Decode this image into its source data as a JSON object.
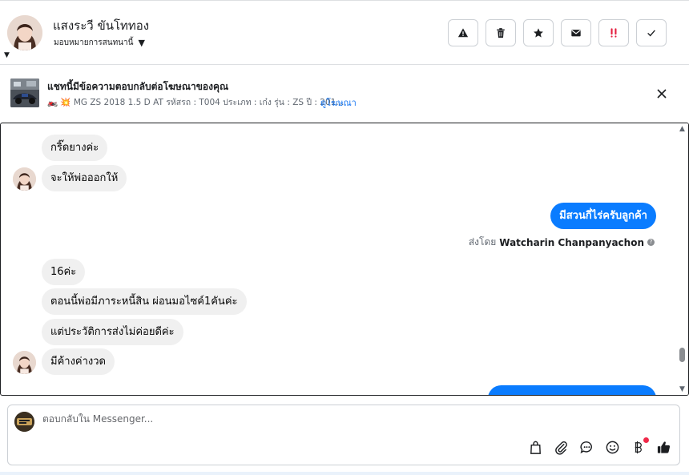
{
  "header": {
    "contact_name": "แสงระวี ขันโททอง",
    "assign_label": "มอบหมายการสนทนานี้",
    "actions": [
      {
        "name": "report-button",
        "icon": "warning-icon"
      },
      {
        "name": "delete-button",
        "icon": "trash-icon"
      },
      {
        "name": "star-button",
        "icon": "star-icon"
      },
      {
        "name": "mark-unread-button",
        "icon": "envelope-icon"
      },
      {
        "name": "follow-up-button",
        "icon": "double-exclamation-icon"
      },
      {
        "name": "mark-done-button",
        "icon": "check-icon"
      }
    ]
  },
  "ad_reply": {
    "title": "แชทนี้มีข้อความตอบกลับต่อโฆษณาของคุณ",
    "subtitle": "🏍️ 💥 MG ZS 2018 1.5 D AT รหัสรถ : T004 ประเภท : เก๋ง รุ่น : ZS ปี : 201...",
    "link": "ดูโฆษณา"
  },
  "messages": {
    "m1": "กริ๊ดยางค่ะ",
    "m2": "จะให้พ่อออกให้",
    "m3": "มีสวนกี่ไร่ครับลูกค้า",
    "sent_by_prefix": "ส่งโดย",
    "sent_by_name": "Watcharin Chanpanyachon",
    "m4": "16ค่ะ",
    "m5": "ตอนนี้พ่อมีภาระหนี้สิน ผ่อนมอไซค์1คันค่ะ",
    "m6": "แต่ประวัติการส่งไม่ค่อยดีค่ะ",
    "m7": "มีค้างค่างวด"
  },
  "composer": {
    "placeholder": "ตอบกลับใน Messenger...",
    "tools": [
      "bag-icon",
      "paperclip-icon",
      "chat-bubble-icon",
      "smiley-icon",
      "baht-icon",
      "thumbs-up-icon"
    ]
  },
  "colors": {
    "accent": "#0a7cff",
    "incoming_bubble": "#f0f0f0",
    "link": "#1877f2",
    "danger": "#e41e3f"
  }
}
